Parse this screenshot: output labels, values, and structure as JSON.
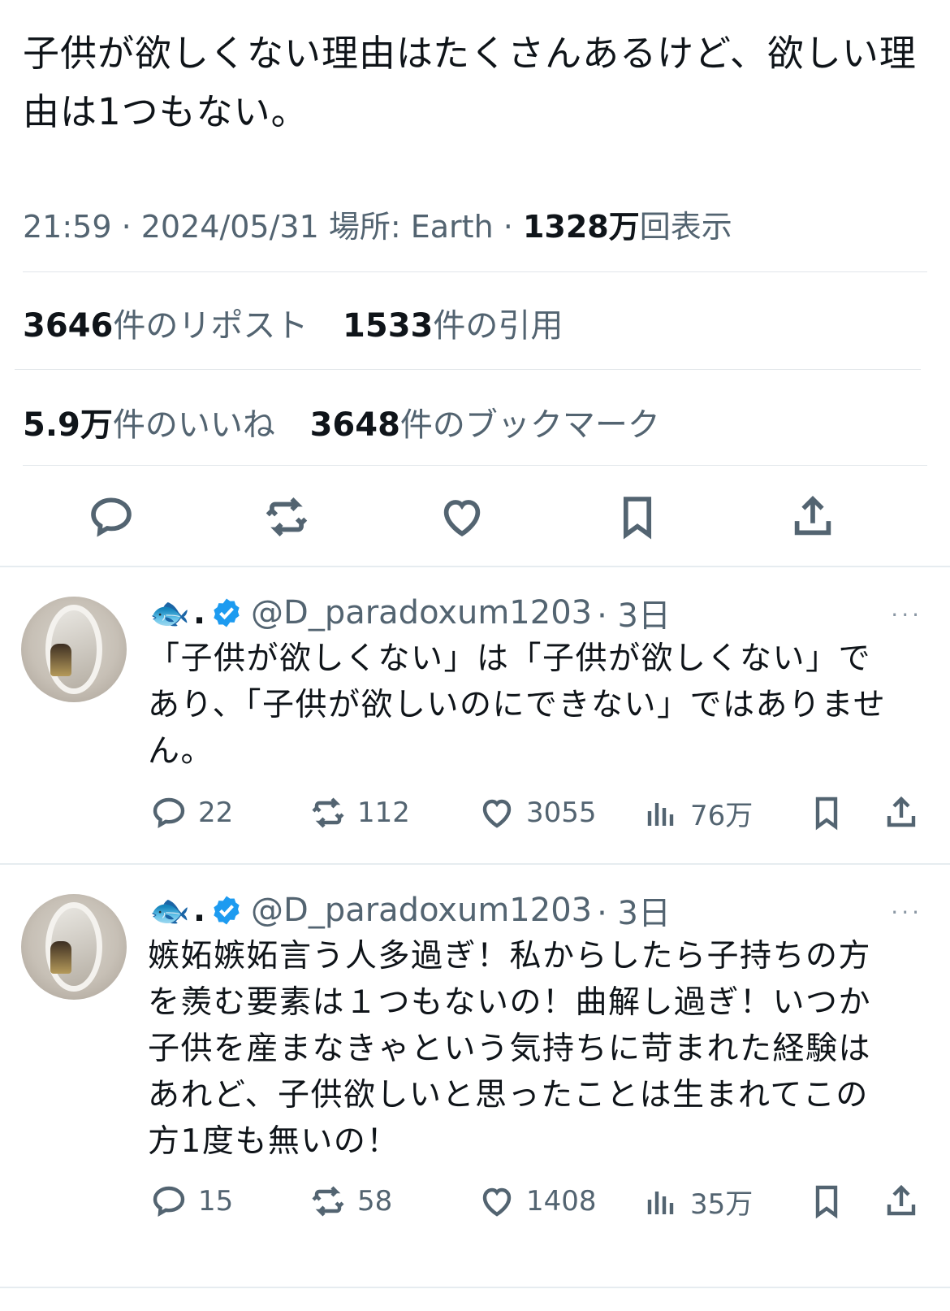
{
  "tweet": {
    "text": "子供が欲しくない理由はたくさんあるけど、欲しい理由は1つもない。",
    "time": "21:59 · 2024/05/31",
    "location": "場所: Earth",
    "views_num": "1328万",
    "views_label": "回表示",
    "reposts_num": "3646",
    "reposts_label": "件のリポスト",
    "quotes_num": "1533",
    "quotes_label": "件の引用",
    "likes_num": "5.9万",
    "likes_label": "件のいいね",
    "bookmarks_num": "3648",
    "bookmarks_label": "件のブックマーク"
  },
  "replies": [
    {
      "name_emoji": "🐟",
      "name_dot": ".",
      "handle": "@D_paradoxum1203",
      "time": "· 3日",
      "text": "「子供が欲しくない」は「子供が欲しくない」であり、「子供が欲しいのにできない」ではありません。",
      "replies": "22",
      "reposts": "112",
      "likes": "3055",
      "views": "76万"
    },
    {
      "name_emoji": "🐟",
      "name_dot": ".",
      "handle": "@D_paradoxum1203",
      "time": "· 3日",
      "text": "嫉妬嫉妬言う人多過ぎ！私からしたら子持ちの方を羨む要素は１つもないの！曲解し過ぎ！いつか子供を産まなきゃという気持ちに苛まれた経験はあれど、子供欲しいと思ったことは生まれてこの方1度も無いの！",
      "replies": "15",
      "reposts": "58",
      "likes": "1408",
      "views": "35万"
    }
  ],
  "colors": {
    "text": "#0f1419",
    "secondary": "#536471",
    "verified": "#1d9bf0",
    "divider": "#e1e6ea"
  },
  "more_icon": "···"
}
